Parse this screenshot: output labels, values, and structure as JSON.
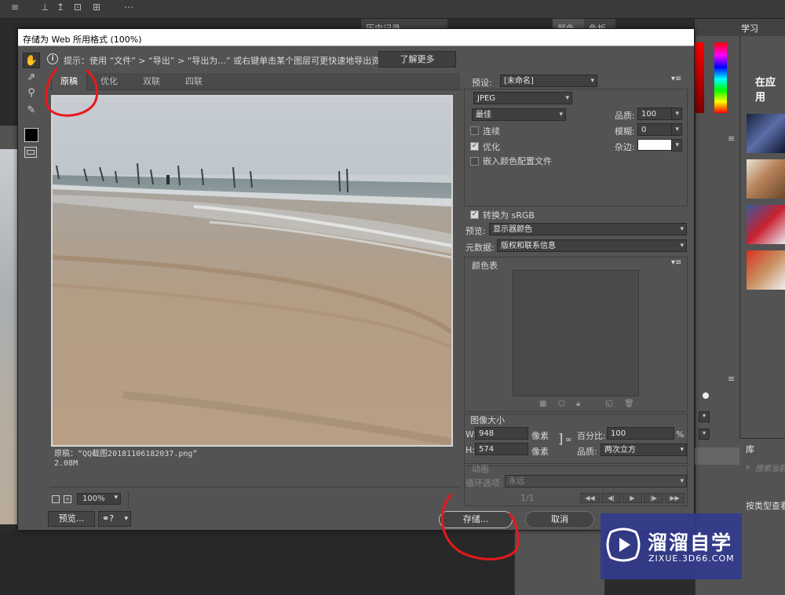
{
  "app": {
    "topbar_glyphs": [
      "≡",
      "⊥",
      "↥",
      "⊡",
      "⊞",
      "⋯"
    ],
    "panel_tabs": [
      "历史记录",
      "颜色",
      "色板"
    ],
    "learn_panel": {
      "title": "学习",
      "subtitle": "在应用"
    },
    "library_panel": {
      "title": "库",
      "search_placeholder": "搜索当前",
      "sort_label": "按类型查看"
    }
  },
  "dialog": {
    "title": "存储为 Web 所用格式 (100%)",
    "hint_text": "提示：使用 “文件” > “导出” > “导出为...” 或右键单击某个图层可更快速地导出资源",
    "learn_more": "了解更多",
    "tabs": [
      {
        "label": "原稿",
        "active": true
      },
      {
        "label": "优化",
        "active": false
      },
      {
        "label": "双联",
        "active": false
      },
      {
        "label": "四联",
        "active": false
      }
    ],
    "image_info": {
      "line1": "原稿：“QQ截图20181106182037.png”",
      "line2": "2.08M"
    },
    "zoom": {
      "value": "100%"
    },
    "buttons": {
      "preview": "预览...",
      "save": "存储...",
      "cancel": "取消"
    },
    "settings": {
      "preset_label": "预设:",
      "preset_value": "[未命名]",
      "format_value": "JPEG",
      "quality_level": "最佳",
      "quality_label": "品质:",
      "quality_value": "100",
      "blur_label": "模糊:",
      "blur_value": "0",
      "matte_label": "杂边:",
      "progressive": {
        "label": "连续",
        "checked": false
      },
      "optimized": {
        "label": "优化",
        "checked": true
      },
      "embed_profile": {
        "label": "嵌入颜色配置文件",
        "checked": false
      },
      "convert_srgb": {
        "label": "转换为 sRGB",
        "checked": true
      },
      "preview_label": "预览:",
      "preview_value": "显示器颜色",
      "metadata_label": "元数据:",
      "metadata_value": "版权和联系信息"
    },
    "color_table": {
      "title": "颜色表"
    },
    "image_size": {
      "title": "图像大小",
      "w_label": "W:",
      "w_value": "948",
      "h_label": "H:",
      "h_value": "574",
      "unit": "像素",
      "percent_label": "百分比:",
      "percent_value": "100",
      "percent_unit": "%",
      "quality_label": "品质:",
      "quality_value": "两次立方"
    },
    "animation": {
      "title": "动画",
      "loop_label": "循环选项:",
      "loop_value": "永远",
      "frame_counter": "1/1"
    }
  },
  "watermark": {
    "title": "溜溜自学",
    "url": "ZIXUE.3D66.COM"
  },
  "colors": {
    "annotation_red": "#e8181c",
    "dialog_bg": "#535353",
    "watermark_bg": "#333a8c"
  }
}
